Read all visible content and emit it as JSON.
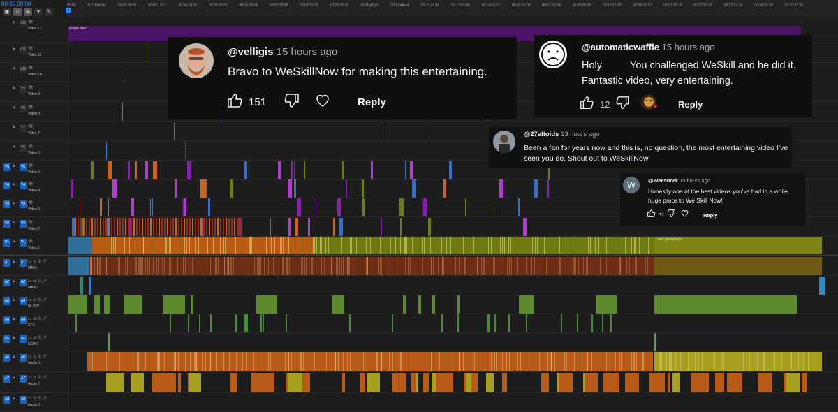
{
  "timecode": "00;00;00;00",
  "ruler": {
    "ticks": [
      "00;00",
      "00;01;04;04",
      "00;02;08;08",
      "00;03;12;12",
      "00;04;16;16",
      "00;05;20;20",
      "00;06;24;24",
      "00;07;28;28",
      "00;08;32;32",
      "00;09;36;36",
      "00;10;40;40",
      "00;11;44;44",
      "00;12;48;48",
      "00;13;52;48",
      "00;14;56;52",
      "00;16;01;00",
      "00;17;05;04",
      "00;18;09;08",
      "00;19;13;12",
      "00;20;17;12",
      "00;21;21;16",
      "00;22;25;20",
      "00;23;29;24",
      "00;24;33;28",
      "00;25;37;32"
    ]
  },
  "tracks": [
    {
      "id": "V12",
      "name": "Video 12",
      "src": ""
    },
    {
      "id": "V11",
      "name": "Video 11",
      "src": ""
    },
    {
      "id": "V10",
      "name": "Video 10",
      "src": ""
    },
    {
      "id": "V9",
      "name": "Video 9",
      "src": ""
    },
    {
      "id": "V8",
      "name": "Video 8",
      "src": ""
    },
    {
      "id": "V7",
      "name": "Video 7",
      "src": ""
    },
    {
      "id": "V6",
      "name": "Video 6",
      "src": ""
    },
    {
      "id": "V5",
      "name": "Video 5",
      "src": "V5"
    },
    {
      "id": "V4",
      "name": "Video 4",
      "src": "V4"
    },
    {
      "id": "V3",
      "name": "Video 3",
      "src": "V3"
    },
    {
      "id": "V2",
      "name": "Video 2",
      "src": "V2"
    },
    {
      "id": "V1",
      "name": "Video 1",
      "src": "V1"
    },
    {
      "id": "A1",
      "name": "MAIN",
      "src": "A1"
    },
    {
      "id": "A2",
      "name": "MAIN2",
      "src": "A2"
    },
    {
      "id": "A3",
      "name": "MUSIC",
      "src": "A3"
    },
    {
      "id": "A4",
      "name": "SFX",
      "src": "A4"
    },
    {
      "id": "A5",
      "name": "ECHO",
      "src": "A5"
    },
    {
      "id": "A6",
      "name": "Audio 6",
      "src": "A6"
    },
    {
      "id": "A7",
      "name": "Audio 7",
      "src": "A7"
    },
    {
      "id": "A8",
      "name": "Audio 8",
      "src": "A8"
    }
  ],
  "clip_labels": {
    "purple_filler": "purple filler",
    "next_gameplay": "next gameplays"
  },
  "colors": {
    "accent": "#2f7df0",
    "video": "#6f7a12",
    "audio_main": "#6b3a1f",
    "music": "#7bb046",
    "audio_orange": "#c8651f",
    "purple": "#7a1fa0",
    "comment_bg": "#0f0f0f"
  },
  "comments": [
    {
      "handle": "@velligis",
      "time": "15 hours ago",
      "text": "Bravo to WeSkillNow for making this entertaining.",
      "likes": "151",
      "reply": "Reply",
      "avatar": "bearded-man-avatar"
    },
    {
      "handle": "@automaticwaffle",
      "time": "15 hours ago",
      "text": "Holy          You challenged WeSkill and he did it. Fantastic video, very entertaining.",
      "likes": "12",
      "reply": "Reply",
      "avatar": "sad-face-avatar"
    },
    {
      "handle": "@27altoids",
      "time": "13 hours ago",
      "text": "Been a fan for years now and this is, no question, the most entertaining video I’ve seen you do. Shout out to WeSkillNow",
      "avatar": "person-avatar"
    },
    {
      "handle": "@Weesnork",
      "time": "15 hours ago",
      "text": "Honestly one of the best videos you’ve had in a while, huge props to We Skill Now!",
      "likes": "32",
      "reply": "Reply",
      "avatar_letter": "W"
    }
  ]
}
